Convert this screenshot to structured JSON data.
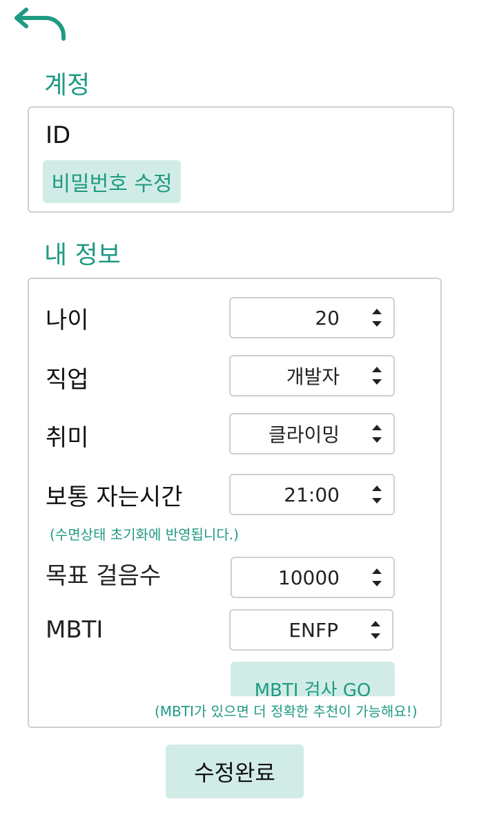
{
  "header": {
    "back_icon": "arrow-back-icon",
    "accent_color": "#1f9a83"
  },
  "account": {
    "title": "계정",
    "id_label": "ID",
    "change_password_label": "비밀번호 수정"
  },
  "info": {
    "title": "내 정보",
    "rows": [
      {
        "label": "나이",
        "value": "20"
      },
      {
        "label": "직업",
        "value": "개발자"
      },
      {
        "label": "취미",
        "value": "클라이밍"
      },
      {
        "label": "보통 자는시간",
        "value": "21:00"
      },
      {
        "label": "목표 걸음수",
        "value": "10000"
      },
      {
        "label": "MBTI",
        "value": "ENFP"
      }
    ],
    "sleep_hint": "(수면상태 초기화에 반영됩니다.)",
    "mbti_test_label": "MBTI 검사 GO",
    "mbti_hint": "(MBTI가 있으면 더 정확한 추천이 가능해요!)"
  },
  "footer": {
    "submit_label": "수정완료",
    "button_bg": "#d1ece6"
  }
}
